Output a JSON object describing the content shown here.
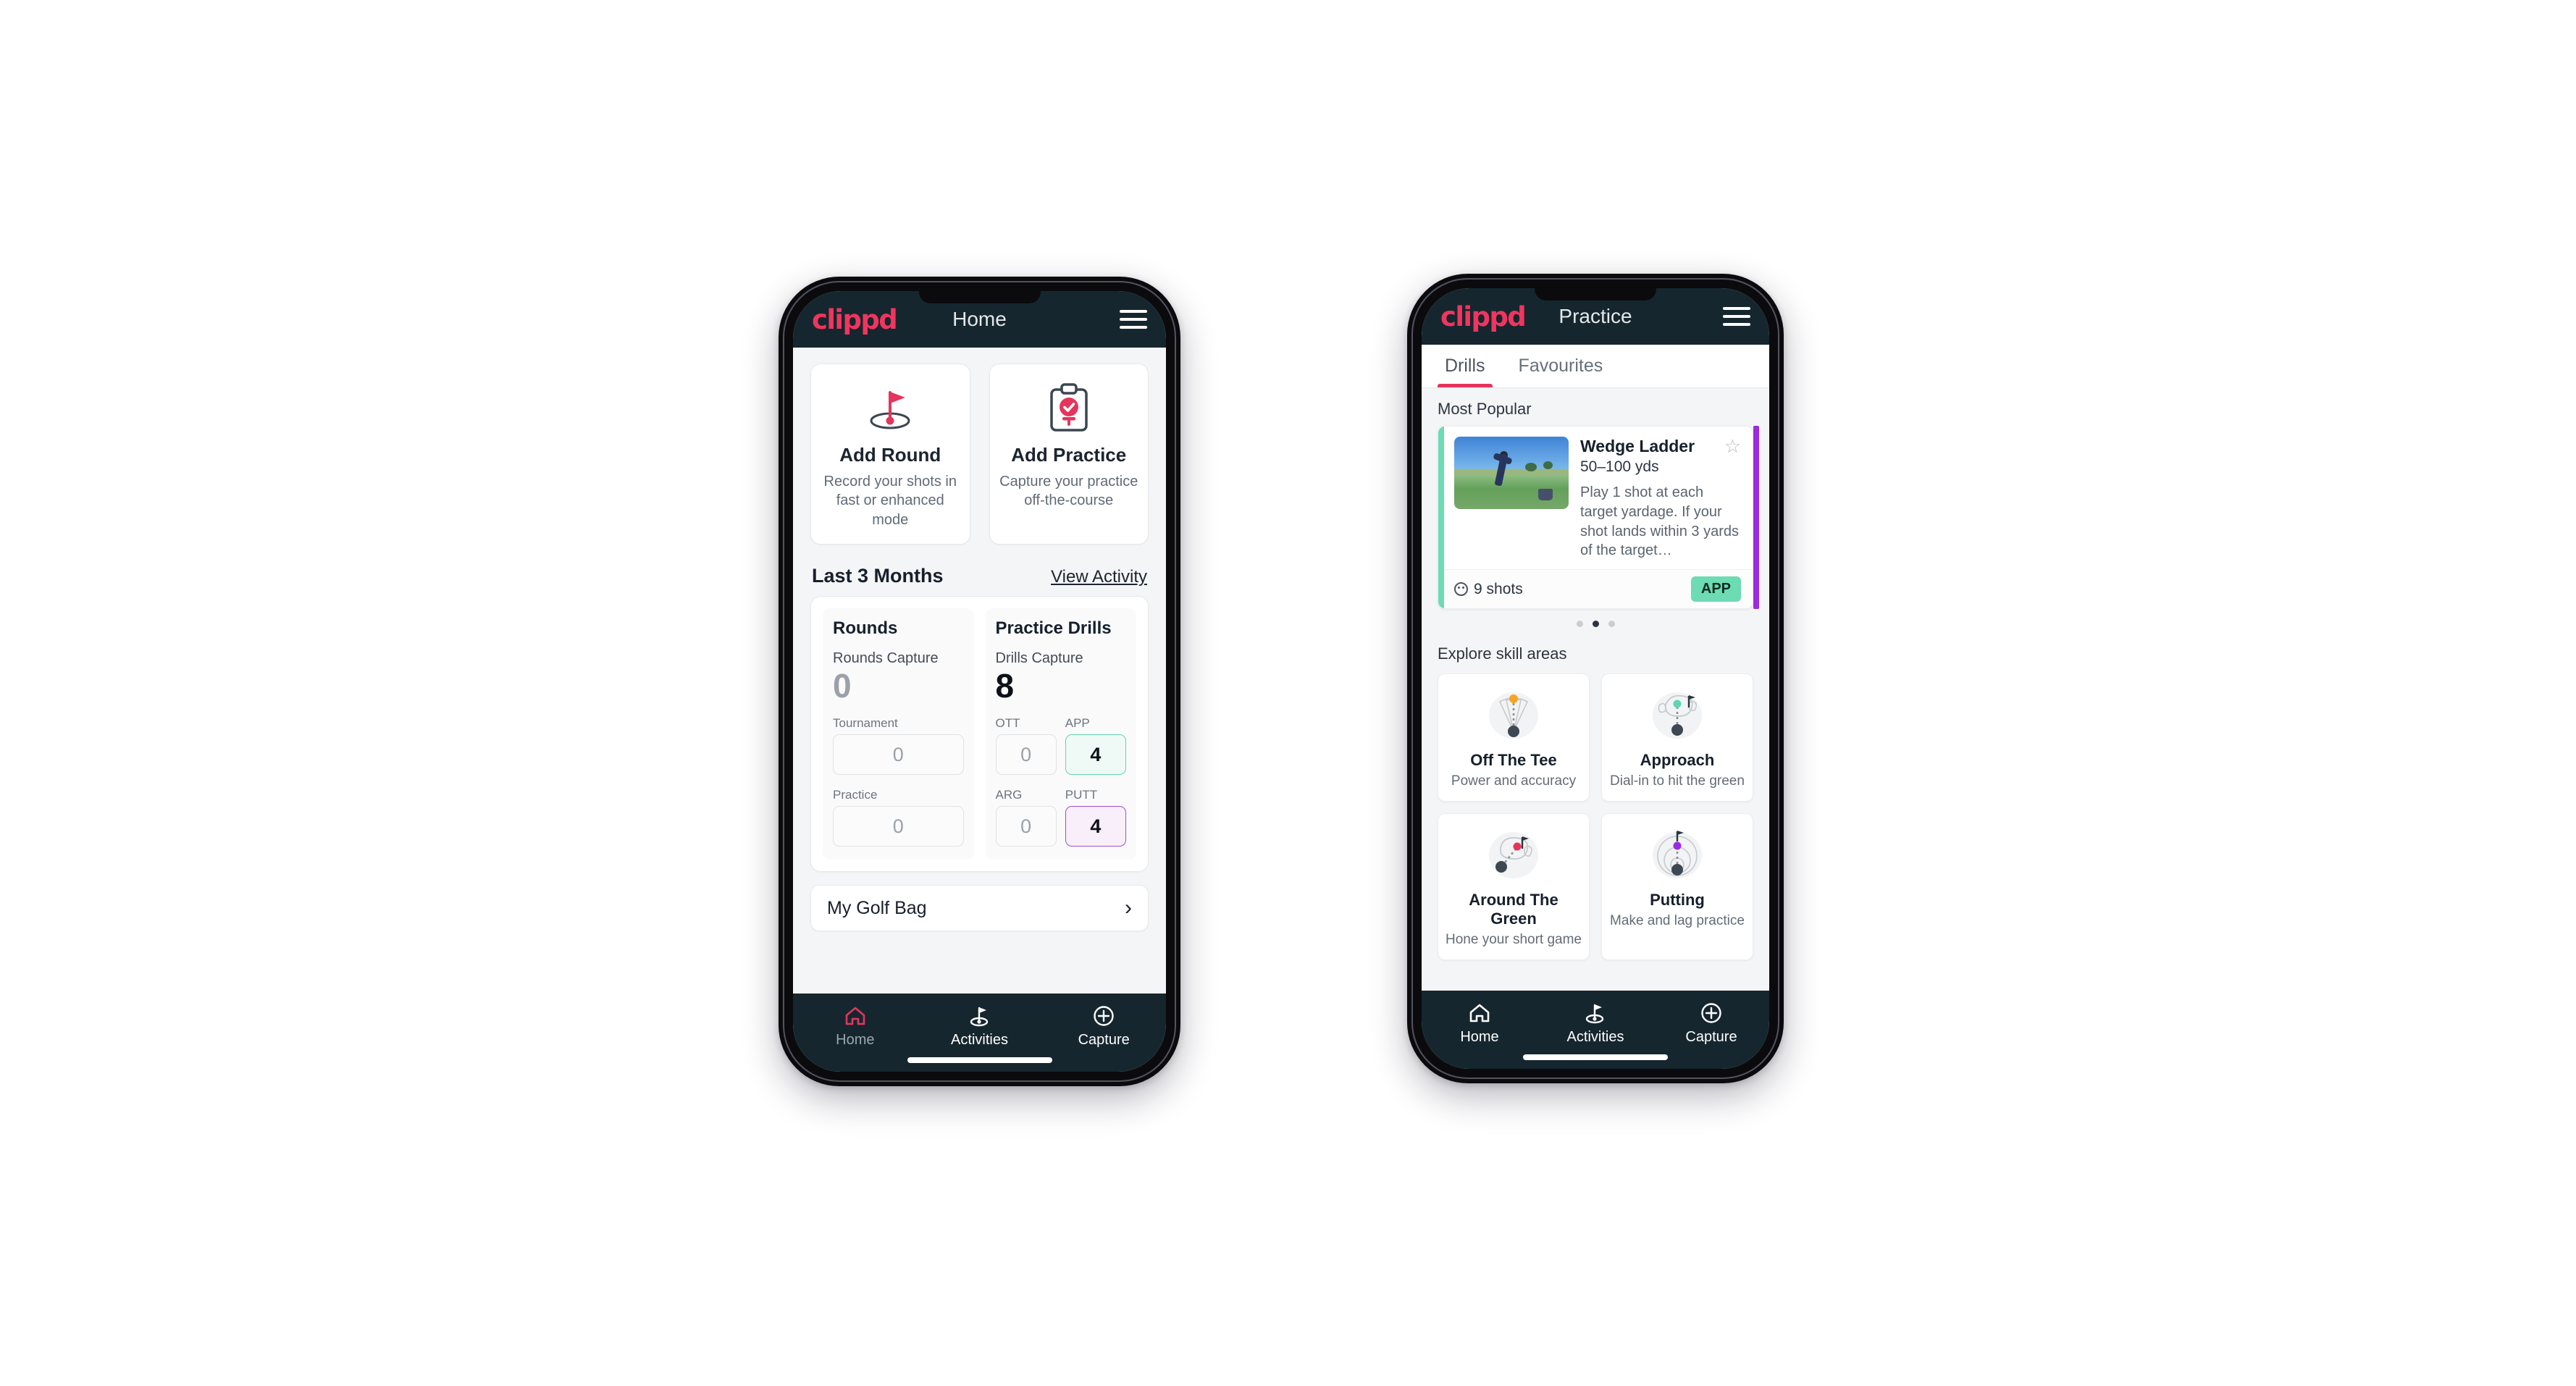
{
  "theme": {
    "brand_pink": "#f0355e",
    "appbar_bg": "#16262f",
    "mint": "#6ddbb4",
    "purple": "#9b2ae0",
    "tab_accent": "#e5355d"
  },
  "home_phone": {
    "appbar": {
      "logo": "clippd",
      "title": "Home",
      "menu_icon": "hamburger-menu-icon"
    },
    "actions": [
      {
        "icon": "golf-flag-hole-icon",
        "title": "Add Round",
        "subtitle": "Record your shots in fast or enhanced mode"
      },
      {
        "icon": "clipboard-check-tee-icon",
        "title": "Add Practice",
        "subtitle": "Capture your practice off-the-course"
      }
    ],
    "section": {
      "title": "Last 3 Months",
      "link": "View Activity"
    },
    "rounds": {
      "heading": "Rounds",
      "capture_label": "Rounds Capture",
      "capture_value": "0",
      "fields": [
        {
          "label": "Tournament",
          "value": "0",
          "state": "empty"
        },
        {
          "label": "Practice",
          "value": "0",
          "state": "empty"
        }
      ]
    },
    "drills": {
      "heading": "Practice Drills",
      "capture_label": "Drills Capture",
      "capture_value": "8",
      "fields": [
        {
          "label": "OTT",
          "value": "0",
          "state": "empty"
        },
        {
          "label": "APP",
          "value": "4",
          "state": "green"
        },
        {
          "label": "ARG",
          "value": "0",
          "state": "empty"
        },
        {
          "label": "PUTT",
          "value": "4",
          "state": "purple"
        }
      ]
    },
    "golf_bag": {
      "label": "My Golf Bag",
      "chevron": "chevron-right-icon"
    },
    "bottom_nav": [
      {
        "icon": "home-icon",
        "label": "Home",
        "active": true
      },
      {
        "icon": "golf-flag-icon",
        "label": "Activities",
        "active": false
      },
      {
        "icon": "plus-circle-icon",
        "label": "Capture",
        "active": false
      }
    ]
  },
  "practice_phone": {
    "appbar": {
      "logo": "clippd",
      "title": "Practice",
      "menu_icon": "hamburger-menu-icon"
    },
    "tabs": [
      {
        "label": "Drills",
        "active": true
      },
      {
        "label": "Favourites",
        "active": false
      }
    ],
    "most_popular": {
      "label": "Most Popular",
      "card": {
        "title": "Wedge Ladder",
        "yardage": "50–100 yds",
        "description": "Play 1 shot at each target yardage. If your shot lands within 3 yards of the target…",
        "shots": "9 shots",
        "shots_icon": "golf-ball-icon",
        "badge": "APP",
        "favourite_icon": "star-outline-icon",
        "thumbnail": "golfer-chipping-photo",
        "accent_color": "#6ddbb4"
      },
      "pager": {
        "count": 3,
        "active_index": 1
      }
    },
    "skill_areas": {
      "label": "Explore skill areas",
      "cards": [
        {
          "icon": "tee-shot-dispersion-icon",
          "title": "Off The Tee",
          "subtitle": "Power and accuracy",
          "dot_color": "#f5a623"
        },
        {
          "icon": "approach-green-icon",
          "title": "Approach",
          "subtitle": "Dial-in to hit the green",
          "dot_color": "#5fd6ae"
        },
        {
          "icon": "around-green-icon",
          "title": "Around The Green",
          "subtitle": "Hone your short game",
          "dot_color": "#e5355d"
        },
        {
          "icon": "putting-rings-icon",
          "title": "Putting",
          "subtitle": "Make and lag practice",
          "dot_color": "#9b2ae0"
        }
      ]
    },
    "bottom_nav": [
      {
        "icon": "home-icon",
        "label": "Home",
        "active": false
      },
      {
        "icon": "golf-flag-icon",
        "label": "Activities",
        "active": false
      },
      {
        "icon": "plus-circle-icon",
        "label": "Capture",
        "active": false
      }
    ]
  }
}
